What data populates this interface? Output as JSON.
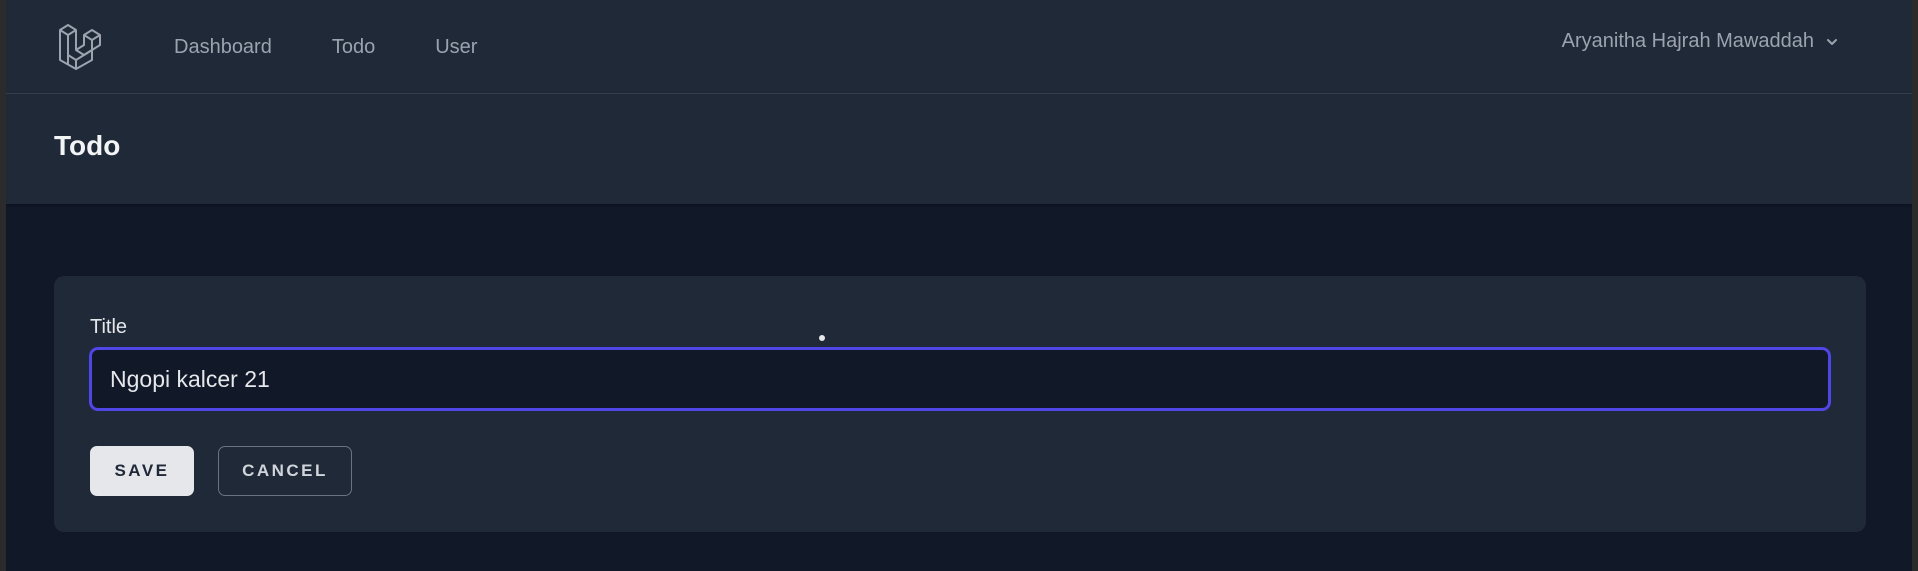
{
  "nav": {
    "logo_icon": "laravel-logo-icon",
    "links": [
      {
        "label": "Dashboard"
      },
      {
        "label": "Todo"
      },
      {
        "label": "User"
      }
    ],
    "user_name": "Aryanitha Hajrah Mawaddah",
    "user_chevron_icon": "chevron-down-icon"
  },
  "header": {
    "title": "Todo"
  },
  "form": {
    "title_label": "Title",
    "title_value": "Ngopi kalcer 21",
    "save_label": "SAVE",
    "cancel_label": "CANCEL"
  },
  "colors": {
    "background": "#111827",
    "surface": "#1f2937",
    "input_focus": "#4f46e5",
    "text_muted": "#9ca3af"
  }
}
